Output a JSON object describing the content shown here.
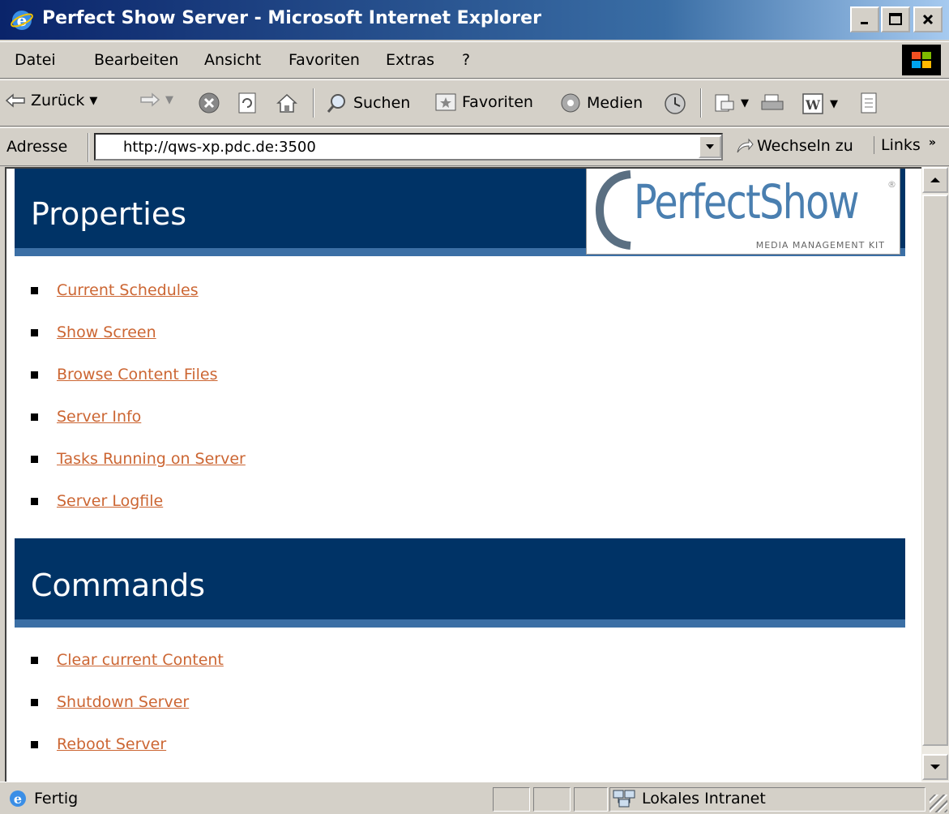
{
  "window": {
    "title": "Perfect Show Server - Microsoft Internet Explorer"
  },
  "menu": [
    "Datei",
    "Bearbeiten",
    "Ansicht",
    "Favoriten",
    "Extras",
    "?"
  ],
  "toolbar": {
    "back_label": "Zurück",
    "search_label": "Suchen",
    "favorites_label": "Favoriten",
    "media_label": "Medien"
  },
  "address": {
    "label": "Adresse",
    "url": "http://qws-xp.pdc.de:3500",
    "go_label": "Wechseln zu",
    "links_label": "Links"
  },
  "page": {
    "logo": {
      "name": "PerfectShow",
      "tagline": "MEDIA MANAGEMENT KIT"
    },
    "properties": {
      "heading": "Properties",
      "links": [
        "Current Schedules",
        "Show Screen",
        "Browse Content Files",
        "Server Info",
        "Tasks Running on Server",
        "Server Logfile"
      ]
    },
    "commands": {
      "heading": "Commands",
      "links": [
        "Clear current Content",
        "Shutdown Server",
        "Reboot Server"
      ]
    }
  },
  "status": {
    "text": "Fertig",
    "zone": "Lokales Intranet"
  },
  "colors": {
    "header_bg": "#003366",
    "header_stripe": "#3b6fa5",
    "link": "#cc6633",
    "logo": "#4a7fb0"
  }
}
